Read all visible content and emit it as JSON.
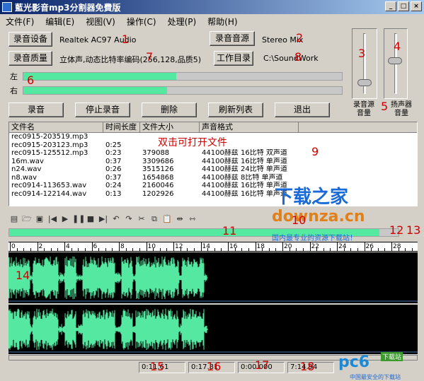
{
  "window": {
    "title": "藍光影音mp3分割器免費版",
    "min": "_",
    "max": "□",
    "close": "×"
  },
  "menu": [
    "文件(F)",
    "编辑(E)",
    "视图(V)",
    "操作(C)",
    "处理(P)",
    "帮助(H)"
  ],
  "device": {
    "button": "录音设备",
    "value": "Realtek AC97 Audio"
  },
  "source": {
    "button": "录音音源",
    "value": "Stereo Mix"
  },
  "quality": {
    "button": "录音质量",
    "value": "立体声,动态比特率编码(256,128,品质5)"
  },
  "workdir": {
    "button": "工作目录",
    "value": "C:\\SoundWork"
  },
  "levels": {
    "left_label": "左",
    "right_label": "右",
    "left": 0.48,
    "right": 0.45
  },
  "volume": {
    "source_label": "录音源\n音量",
    "speaker_label": "扬声器\n音量",
    "source_level": 0.15,
    "speaker_level": 0.55
  },
  "actions": [
    "录音",
    "停止录音",
    "删除",
    "刷新列表",
    "退出"
  ],
  "list": {
    "headers": [
      "文件名",
      "时间长度",
      "文件大小",
      "声音格式"
    ],
    "hint": "双击可打开文件",
    "rows": [
      [
        "rec0915-203519.mp3",
        "",
        "",
        ""
      ],
      [
        "rec0915-203123.mp3",
        "0:25",
        "",
        ""
      ],
      [
        "rec0915-125512.mp3",
        "0:23",
        "379088",
        "44100赫兹 16比特 双声道"
      ],
      [
        "16m.wav",
        "0:37",
        "3309686",
        "44100赫兹 16比特 单声道"
      ],
      [
        "n24.wav",
        "0:26",
        "3515126",
        "44100赫兹 24比特 单声道"
      ],
      [
        "n8.wav",
        "0:37",
        "1654868",
        "44100赫兹 8比特 单声道"
      ],
      [
        "rec0914-113653.wav",
        "0:24",
        "2160046",
        "44100赫兹 16比特 单声道"
      ],
      [
        "rec0914-122144.wav",
        "0:13",
        "1202926",
        "44100赫兹 16比特 单声道"
      ]
    ]
  },
  "toolbar_icons": [
    "open-icon",
    "open-folder-icon",
    "save-icon",
    "skip-back-icon",
    "play-icon",
    "pause-icon",
    "stop-icon",
    "skip-forward-icon",
    "undo-icon",
    "redo-icon",
    "cut-icon",
    "copy-icon",
    "paste-icon",
    "trim-icon",
    "split-icon"
  ],
  "toolbar_glyphs": [
    "▤",
    "🗁",
    "▣",
    "|◀",
    "▶",
    "❚❚",
    "■",
    "▶|",
    "↶",
    "↷",
    "✂",
    "⧉",
    "📋",
    "⇹",
    "⇿"
  ],
  "ruler_ticks": [
    "0",
    "2",
    "4",
    "6",
    "8",
    "10",
    "12",
    "14",
    "16",
    "18",
    "20",
    "22",
    "24",
    "26",
    "28"
  ],
  "progress": 0.95,
  "status": {
    "s1": "0:11.61",
    "s2": "0:17.81",
    "s3": "0:00.000",
    "s4": "7:14.94"
  },
  "annotations": [
    "1",
    "2",
    "3",
    "4",
    "5",
    "6",
    "7",
    "8",
    "9",
    "10",
    "11",
    "12",
    "13",
    "14",
    "15",
    "16",
    "17",
    "18"
  ],
  "watermarks": {
    "w1": "下载之家",
    "w2": "downza.cn",
    "w3": "国内最专业的资源下载站！",
    "w4": "pc6",
    "w5": "下载站",
    "w6": "中国最安全的下载站"
  },
  "colors": {
    "meter": "#55e8a0",
    "wave": "#55e8a0",
    "annotation": "#d00000"
  }
}
